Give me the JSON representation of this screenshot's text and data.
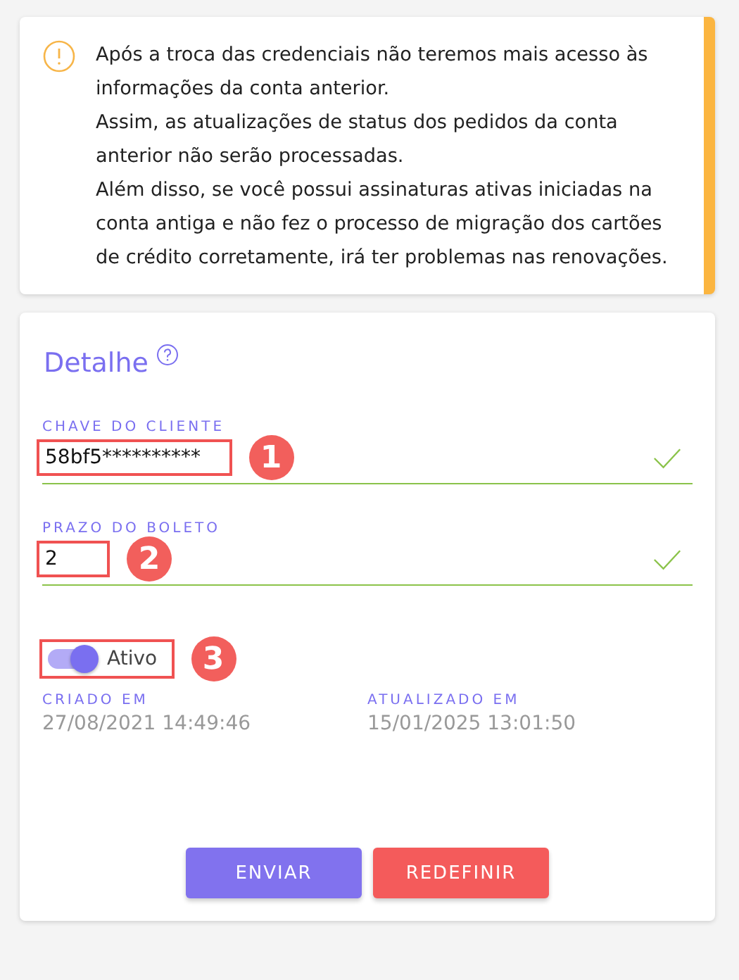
{
  "alert": {
    "lines": [
      "Após a troca das credenciais não teremos mais acesso às informações da conta anterior.",
      "Assim, as atualizações de status dos pedidos da conta anterior não serão processadas.",
      "Além disso, se você possui assinaturas ativas iniciadas na conta antiga e não fez o processo de migração dos cartões de crédito corretamente, irá ter problemas nas renovações."
    ]
  },
  "detail": {
    "title": "Detalhe",
    "fields": [
      {
        "label": "CHAVE DO CLIENTE",
        "value": "58bf5**********",
        "valid": true,
        "callout": "1"
      },
      {
        "label": "PRAZO DO BOLETO",
        "value": "2",
        "valid": true,
        "callout": "2"
      }
    ],
    "toggle": {
      "label": "Ativo",
      "on": true,
      "callout": "3"
    },
    "meta": [
      {
        "label": "CRIADO EM",
        "value": "27/08/2021 14:49:46"
      },
      {
        "label": "ATUALIZADO EM",
        "value": "15/01/2025 13:01:50"
      }
    ],
    "buttons": [
      {
        "label": "ENVIAR",
        "kind": "primary"
      },
      {
        "label": "REDEFINIR",
        "kind": "danger"
      }
    ]
  }
}
